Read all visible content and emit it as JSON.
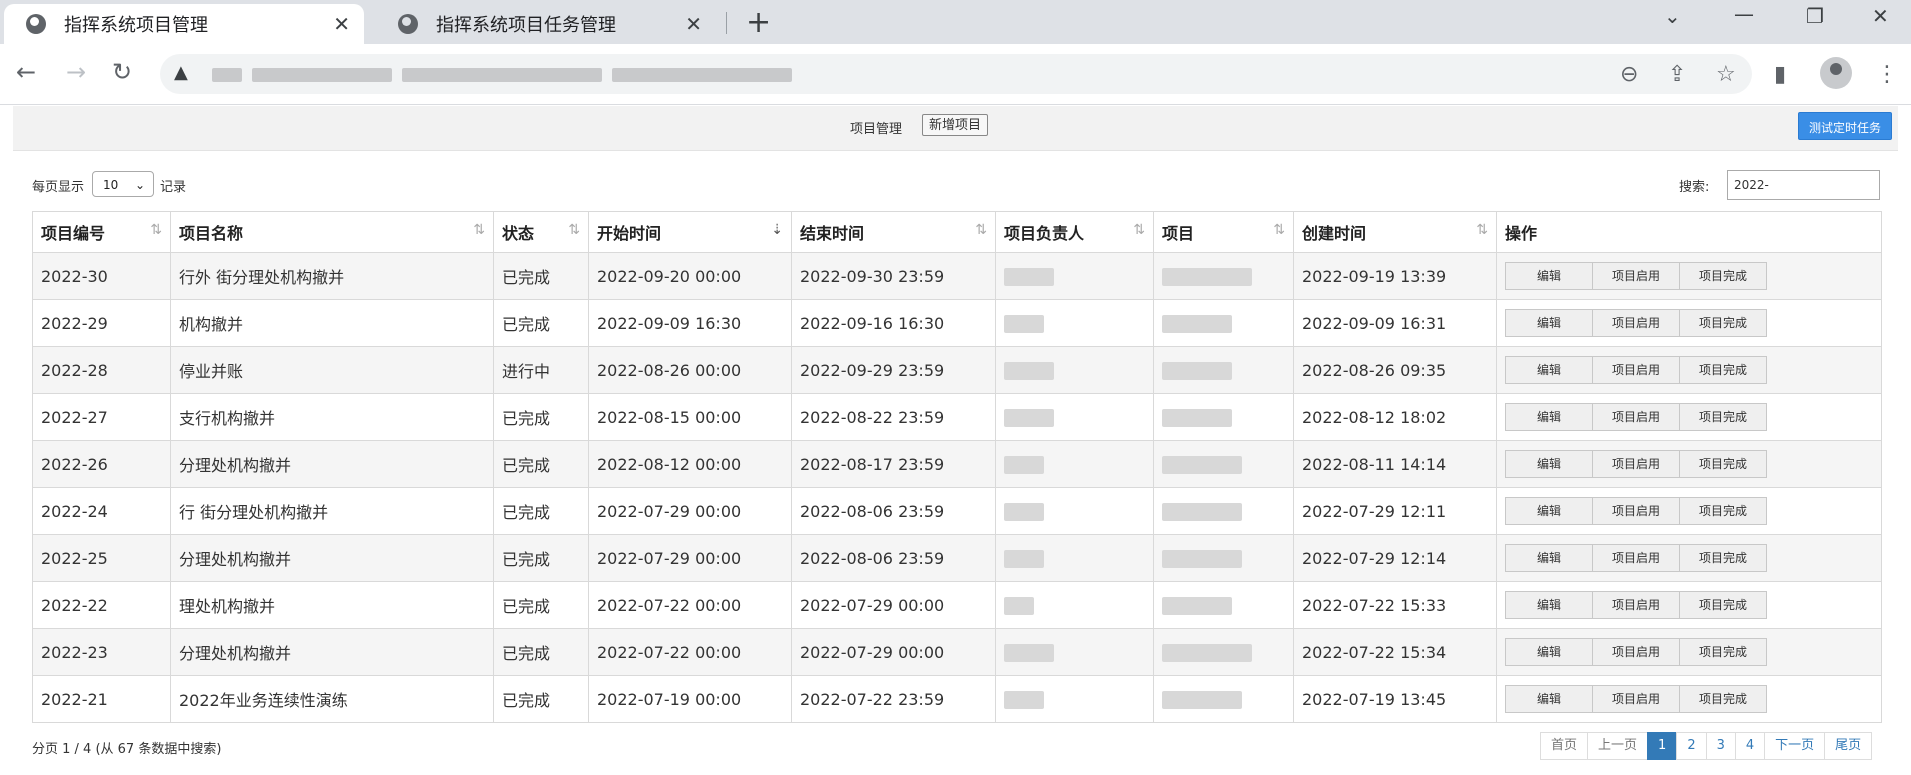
{
  "browser": {
    "tabs": [
      {
        "title": "指挥系统项目管理",
        "active": true
      },
      {
        "title": "指挥系统项目任务管理",
        "active": false
      }
    ],
    "new_tab": "+",
    "close_glyph": "✕"
  },
  "header": {
    "breadcrumb": "项目管理",
    "add_button": "新增项目",
    "timer_button": "测试定时任务"
  },
  "controls": {
    "per_page_prefix": "每页显示",
    "per_page_value": "10",
    "per_page_suffix": "记录",
    "search_label": "搜索:",
    "search_value": "2022-"
  },
  "table": {
    "columns": [
      "项目编号",
      "项目名称",
      "状态",
      "开始时间",
      "结束时间",
      "项目负责人",
      "项目",
      "创建时间",
      "操作"
    ],
    "rows": [
      {
        "id": "2022-30",
        "name": "行外 街分理处机构撤并",
        "status": "已完成",
        "start": "2022-09-20 00:00",
        "end": "2022-09-30 23:59",
        "created": "2022-09-19 13:39"
      },
      {
        "id": "2022-29",
        "name": "机构撤并",
        "status": "已完成",
        "start": "2022-09-09 16:30",
        "end": "2022-09-16 16:30",
        "created": "2022-09-09 16:31"
      },
      {
        "id": "2022-28",
        "name": "停业并账",
        "status": "进行中",
        "start": "2022-08-26 00:00",
        "end": "2022-09-29 23:59",
        "created": "2022-08-26 09:35"
      },
      {
        "id": "2022-27",
        "name": "支行机构撤并",
        "status": "已完成",
        "start": "2022-08-15 00:00",
        "end": "2022-08-22 23:59",
        "created": "2022-08-12 18:02"
      },
      {
        "id": "2022-26",
        "name": "分理处机构撤并",
        "status": "已完成",
        "start": "2022-08-12 00:00",
        "end": "2022-08-17 23:59",
        "created": "2022-08-11 14:14"
      },
      {
        "id": "2022-24",
        "name": "行 街分理处机构撤并",
        "status": "已完成",
        "start": "2022-07-29 00:00",
        "end": "2022-08-06 23:59",
        "created": "2022-07-29 12:11"
      },
      {
        "id": "2022-25",
        "name": "分理处机构撤并",
        "status": "已完成",
        "start": "2022-07-29 00:00",
        "end": "2022-08-06 23:59",
        "created": "2022-07-29 12:14"
      },
      {
        "id": "2022-22",
        "name": "理处机构撤并",
        "status": "已完成",
        "start": "2022-07-22 00:00",
        "end": "2022-07-29 00:00",
        "created": "2022-07-22 15:33"
      },
      {
        "id": "2022-23",
        "name": "分理处机构撤并",
        "status": "已完成",
        "start": "2022-07-22 00:00",
        "end": "2022-07-29 00:00",
        "created": "2022-07-22 15:34"
      },
      {
        "id": "2022-21",
        "name": "2022年业务连续性演练",
        "status": "已完成",
        "start": "2022-07-19 00:00",
        "end": "2022-07-22 23:59",
        "created": "2022-07-19 13:45"
      }
    ],
    "actions": {
      "edit": "编辑",
      "enable": "项目启用",
      "complete": "项目完成"
    }
  },
  "footer": {
    "page_info": "分页 1 / 4 (从 67 条数据中搜索)",
    "pager": {
      "first": "首页",
      "prev": "上一页",
      "pages": [
        "1",
        "2",
        "3",
        "4"
      ],
      "current": "1",
      "next": "下一页",
      "last": "尾页"
    }
  },
  "colors": {
    "accent": "#3a8ee6",
    "pager_active": "#337ab7"
  }
}
